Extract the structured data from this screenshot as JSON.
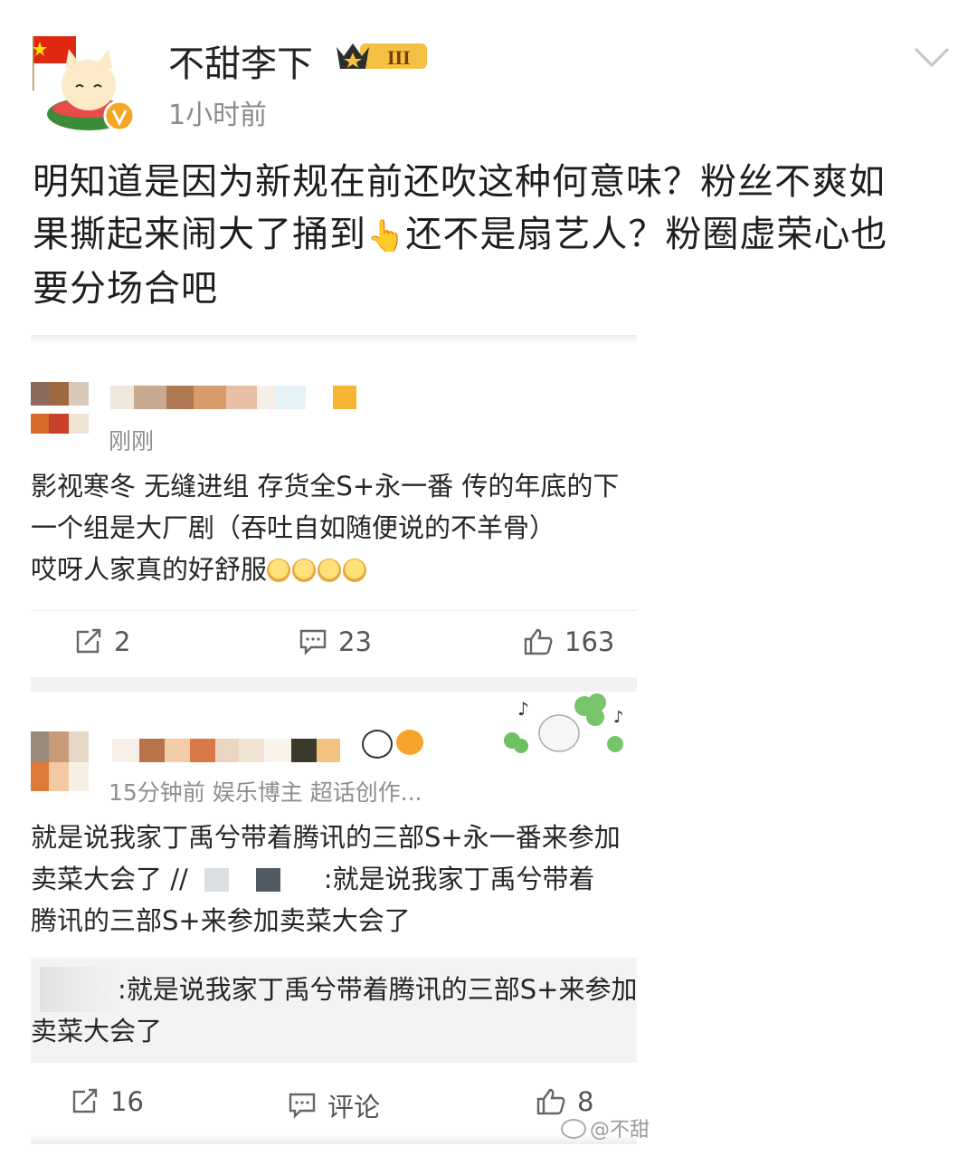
{
  "post": {
    "username": "不甜李下",
    "level_badge": "III",
    "timestamp": "1小时前",
    "body_lines": [
      "明知道是因为新规在前还吹这种何意味？粉丝不爽如",
      "果撕起来闹大了捅到",
      "还不是扇艺人？粉圈虚荣心也",
      "要分场合吧"
    ],
    "pointing_emoji": "👆"
  },
  "card1": {
    "meta": "刚刚",
    "lines": [
      "影视寒冬 无缝进组 存货全S+永一番 传的年底的下",
      "一个组是大厂剧（吞吐自如随便说的不羊骨）",
      "哎呀人家真的好舒服"
    ],
    "repost_count": "2",
    "comment_count": "23",
    "like_count": "163"
  },
  "card2": {
    "meta": "15分钟前  娱乐博主 超话创作...",
    "lines": [
      "就是说我家丁禹兮带着腾讯的三部S+永一番来参加",
      "卖菜大会了 //",
      ":就是说我家丁禹兮带着",
      "腾讯的三部S+来参加卖菜大会了"
    ],
    "quote_lines": [
      ":就是说我家丁禹兮带着腾讯的三部S+来参加",
      "卖菜大会了"
    ],
    "repost_count": "16",
    "comment_label": "评论",
    "like_count": "8"
  },
  "watermark": "@不甜",
  "icons": [
    "avatar-image",
    "crown-badge-icon",
    "chevron-down-icon",
    "repost-icon",
    "comment-icon",
    "like-icon",
    "weibo-logo-icon"
  ],
  "colors": {
    "accent": "#f5a623",
    "text": "#1e1e1e",
    "muted": "#8a8a8a"
  }
}
